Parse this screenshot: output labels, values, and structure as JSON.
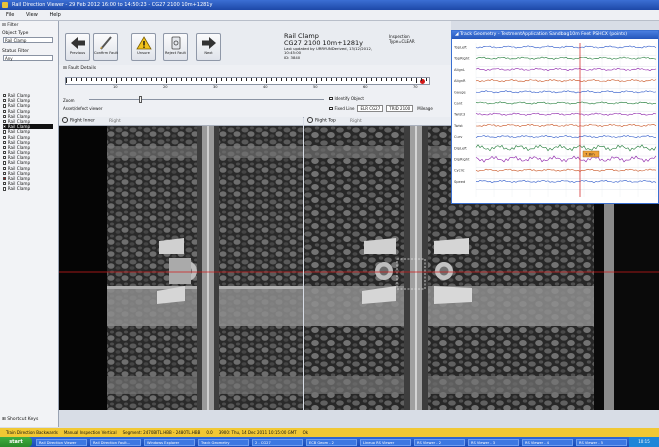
{
  "window": {
    "title": "Rail Direction Viewer - 29 Feb 2012 16:00 to 14:50:23 - CG27 2100 10m+1281y"
  },
  "menu": [
    "File",
    "View",
    "Help"
  ],
  "left_panel": {
    "filter_header": "Filter",
    "object_type_label": "Object Type",
    "object_type_value": "Rail Clamp",
    "status_filter_label": "Status Filter",
    "status_filter_value": "Any",
    "items": [
      {
        "label": "Rail Clamp",
        "state": "normal"
      },
      {
        "label": "Rail Clamp",
        "state": "normal"
      },
      {
        "label": "Rail Clamp",
        "state": "normal"
      },
      {
        "label": "Rail Clamp",
        "state": "normal"
      },
      {
        "label": "Rail Clamp",
        "state": "normal"
      },
      {
        "label": "Rail Clamp",
        "state": "normal"
      },
      {
        "label": "Rail Clamp",
        "state": "active"
      },
      {
        "label": "Rail Clamp",
        "state": "normal"
      },
      {
        "label": "Rail Clamp",
        "state": "normal"
      },
      {
        "label": "Rail Clamp",
        "state": "normal"
      },
      {
        "label": "Rail Clamp",
        "state": "normal"
      },
      {
        "label": "Rail Clamp",
        "state": "normal"
      },
      {
        "label": "Rail Clamp",
        "state": "normal"
      },
      {
        "label": "Rail Clamp",
        "state": "normal"
      },
      {
        "label": "Rail Clamp",
        "state": "normal"
      },
      {
        "label": "Rail Clamp",
        "state": "normal"
      },
      {
        "label": "Rail Clamp",
        "state": "red"
      },
      {
        "label": "Rail Clamp",
        "state": "normal"
      },
      {
        "label": "Rail Clamp",
        "state": "normal"
      }
    ],
    "bottom_label": "Shortcut Keys"
  },
  "toolbar": {
    "buttons": [
      {
        "label": "Previous",
        "icon": "arrow-left-icon"
      },
      {
        "label": "Confirm Fault",
        "icon": "pencil-icon"
      },
      {
        "label": "Unsure",
        "icon": "warning-icon"
      },
      {
        "label": "Reject Fault",
        "icon": "phone-icon"
      },
      {
        "label": "Next",
        "icon": "arrow-right-icon"
      }
    ],
    "record": {
      "title": "Rail Clamp",
      "location": "CG27 2100 10m+1281y",
      "meta": "Last updated by URRYUNDerived, 13/12/2012, 10:45:00",
      "id": "ID: 3840"
    },
    "inspection": {
      "label": "Inspection",
      "value": "Type=CLEAR"
    }
  },
  "fault_details": {
    "caption": "Fault Details",
    "ruler_labels": [
      "10",
      "20",
      "30",
      "40",
      "50",
      "60",
      "70"
    ],
    "zoom_label": "Zoom",
    "asset_label": "Asset/defect viewer",
    "identify_label": "Identify Object",
    "fixed_label": "Fixed Line",
    "fixed_value": "ELR CG27",
    "track_value": "TRID 2100",
    "mileage_label": "Mileage"
  },
  "panels": {
    "left": {
      "title": "Right Inner",
      "right": "Right"
    },
    "right": {
      "title": "Right Top",
      "right": "Right"
    }
  },
  "geometry": {
    "title": "Track Geometry - TestmentApplication Sandbag10m Feet PSHCX (points)",
    "channels": [
      "TopLeft",
      "TopRight",
      "AlignL",
      "AlignR",
      "Gauge",
      "Cant",
      "Twist3",
      "Twist",
      "Curv",
      "DipLeft",
      "DipRight",
      "Cyclic",
      "Speed"
    ],
    "tag": "7.8m"
  },
  "status": [
    "Train Direction Backwards",
    "Manual Inspection Vertical",
    "Segment: 2470BITL.HBB - 2480TL.HBB",
    "0.0",
    "3900: Thu, 14 Dec 2011 10:15:00 GMT",
    "Ok"
  ],
  "taskbar": {
    "start": "start",
    "items": [
      "Rail Direction Viewer",
      "Rail Direction Fault...",
      "Windows Explorer",
      "Track Geometry",
      "2 - CG27",
      "ECB Geom - 2",
      "Lineuo RS Viewer",
      "RS Viewer - 2",
      "RS Viewer - 3",
      "RS Viewer - 4",
      "RS Viewer - 5"
    ],
    "clock": "10:15"
  },
  "colors": {
    "accent": "#2f68d6",
    "status_bar": "#f1c834",
    "fault_marker": "#d01818"
  }
}
